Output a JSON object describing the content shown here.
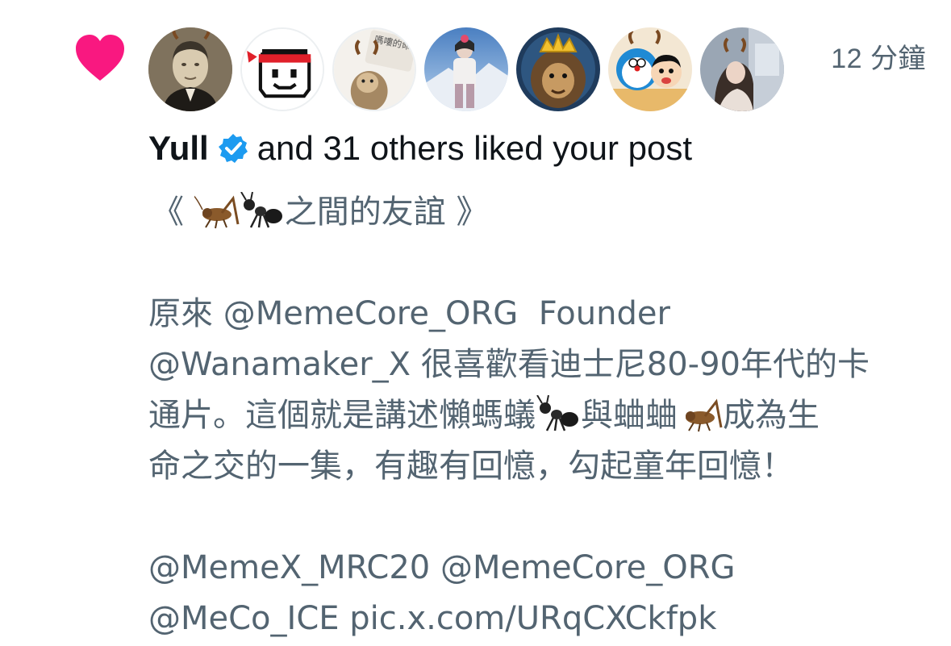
{
  "notification": {
    "icon": "heart-icon",
    "accent_color": "#f91880",
    "timestamp": "12 分鐘",
    "avatars": [
      {
        "name": "avatar-vintage-portrait"
      },
      {
        "name": "avatar-pixel-face"
      },
      {
        "name": "avatar-monkey-meme"
      },
      {
        "name": "avatar-snow-photo"
      },
      {
        "name": "avatar-crowned-monkey"
      },
      {
        "name": "avatar-cartoon-duo"
      },
      {
        "name": "avatar-girl-photo"
      }
    ],
    "headline": {
      "user": "Yull",
      "verified_color": "#1d9bf0",
      "rest": "and 31 others liked your post"
    }
  },
  "post": {
    "title_open": "《",
    "title_text": "之間的友誼",
    "title_close": "》",
    "line1": "原來 @MemeCore_ORG  Founder",
    "line2": "@Wanamaker_X 很喜歡看迪士尼80-90年代的卡",
    "line3_a": "通片。這個就是講述懶螞蟻",
    "line3_b": "與蛐蛐",
    "line3_c": "成為生",
    "line4": "命之交的一集，有趣有回憶，勾起童年回憶！",
    "line5": "@MemeX_MRC20 @MemeCore_ORG",
    "line6": "@MeCo_ICE pic.x.com/URqCXCkfpk",
    "emoji_cricket": "cricket-emoji",
    "emoji_ant": "ant-emoji"
  }
}
